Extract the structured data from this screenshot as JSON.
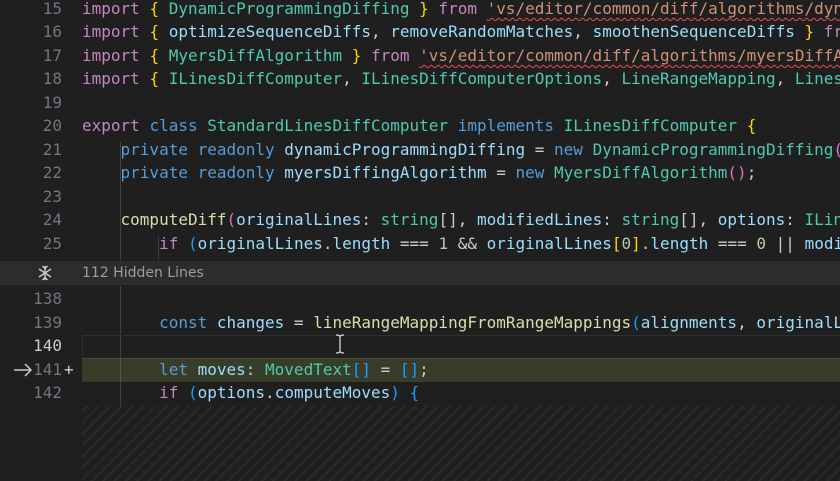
{
  "editor": {
    "lines": [
      {
        "num": "15",
        "tokens": [
          [
            "k",
            "import "
          ],
          [
            "y",
            "{ "
          ],
          [
            "t",
            "DynamicProgrammingDiffing"
          ],
          [
            "y",
            " }"
          ],
          [
            "k",
            " from "
          ],
          [
            "s",
            "'vs/editor/common/diff/algorithms/dyn"
          ]
        ]
      },
      {
        "num": "16",
        "tokens": [
          [
            "k",
            "import "
          ],
          [
            "y",
            "{ "
          ],
          [
            "v",
            "optimizeSequenceDiffs"
          ],
          [
            "p",
            ", "
          ],
          [
            "v",
            "removeRandomMatches"
          ],
          [
            "p",
            ", "
          ],
          [
            "v",
            "smoothenSequenceDiffs"
          ],
          [
            "y",
            " }"
          ],
          [
            "k",
            " fr"
          ]
        ]
      },
      {
        "num": "17",
        "tokens": [
          [
            "k",
            "import "
          ],
          [
            "y",
            "{ "
          ],
          [
            "t",
            "MyersDiffAlgorithm"
          ],
          [
            "y",
            " }"
          ],
          [
            "k",
            " from "
          ],
          [
            "s",
            "'vs/editor/common/diff/algorithms/myersDiffA"
          ]
        ]
      },
      {
        "num": "18",
        "tokens": [
          [
            "k",
            "import "
          ],
          [
            "y",
            "{ "
          ],
          [
            "t",
            "ILinesDiffComputer"
          ],
          [
            "p",
            ", "
          ],
          [
            "t",
            "ILinesDiffComputerOptions"
          ],
          [
            "p",
            ", "
          ],
          [
            "t",
            "LineRangeMapping"
          ],
          [
            "p",
            ", "
          ],
          [
            "t",
            "Lines"
          ]
        ]
      },
      {
        "num": "19",
        "tokens": []
      },
      {
        "num": "20",
        "tokens": [
          [
            "k",
            "export "
          ],
          [
            "kb",
            "class "
          ],
          [
            "t",
            "StandardLinesDiffComputer "
          ],
          [
            "kb",
            "implements "
          ],
          [
            "t",
            "ILinesDiffComputer "
          ],
          [
            "y",
            "{"
          ]
        ]
      },
      {
        "num": "21",
        "tokens": [
          [
            "p",
            "    "
          ],
          [
            "kb",
            "private readonly "
          ],
          [
            "v",
            "dynamicProgrammingDiffing"
          ],
          [
            "p",
            " = "
          ],
          [
            "kb",
            "new "
          ],
          [
            "t",
            "DynamicProgrammingDiffing"
          ],
          [
            "m",
            "("
          ]
        ]
      },
      {
        "num": "22",
        "tokens": [
          [
            "p",
            "    "
          ],
          [
            "kb",
            "private readonly "
          ],
          [
            "v",
            "myersDiffingAlgorithm"
          ],
          [
            "p",
            " = "
          ],
          [
            "kb",
            "new "
          ],
          [
            "t",
            "MyersDiffAlgorithm"
          ],
          [
            "m",
            "()"
          ],
          [
            "p",
            ";"
          ]
        ]
      },
      {
        "num": "23",
        "tokens": []
      },
      {
        "num": "24",
        "tokens": [
          [
            "p",
            "    "
          ],
          [
            "f",
            "computeDiff"
          ],
          [
            "m",
            "("
          ],
          [
            "v",
            "originalLines"
          ],
          [
            "p",
            ": "
          ],
          [
            "t",
            "string"
          ],
          [
            "p",
            "[], "
          ],
          [
            "v",
            "modifiedLines"
          ],
          [
            "p",
            ": "
          ],
          [
            "t",
            "string"
          ],
          [
            "p",
            "[], "
          ],
          [
            "v",
            "options"
          ],
          [
            "p",
            ": "
          ],
          [
            "t",
            "ILin"
          ]
        ]
      },
      {
        "num": "25",
        "tokens": [
          [
            "p",
            "        "
          ],
          [
            "k",
            "if "
          ],
          [
            "bl",
            "("
          ],
          [
            "v",
            "originalLines"
          ],
          [
            "p",
            "."
          ],
          [
            "v",
            "length"
          ],
          [
            "p",
            " === "
          ],
          [
            "n",
            "1"
          ],
          [
            "p",
            " && "
          ],
          [
            "v",
            "originalLines"
          ],
          [
            "y",
            "["
          ],
          [
            "n",
            "0"
          ],
          [
            "y",
            "]"
          ],
          [
            "p",
            "."
          ],
          [
            "v",
            "length"
          ],
          [
            "p",
            " === "
          ],
          [
            "n",
            "0"
          ],
          [
            "p",
            " || "
          ],
          [
            "v",
            "modi"
          ]
        ]
      },
      {
        "num": "138",
        "tokens": []
      },
      {
        "num": "139",
        "tokens": [
          [
            "p",
            "        "
          ],
          [
            "kb",
            "const "
          ],
          [
            "v",
            "changes"
          ],
          [
            "p",
            " = "
          ],
          [
            "f",
            "lineRangeMappingFromRangeMappings"
          ],
          [
            "bl",
            "("
          ],
          [
            "v",
            "alignments"
          ],
          [
            "p",
            ", "
          ],
          [
            "v",
            "originalL"
          ]
        ]
      },
      {
        "num": "140",
        "tokens": []
      },
      {
        "num": "141",
        "tokens": [
          [
            "p",
            "        "
          ],
          [
            "kb",
            "let "
          ],
          [
            "v",
            "moves"
          ],
          [
            "p",
            ": "
          ],
          [
            "t",
            "MovedText"
          ],
          [
            "bl",
            "[]"
          ],
          [
            "p",
            " = "
          ],
          [
            "bl",
            "[]"
          ],
          [
            "p",
            ";"
          ]
        ]
      },
      {
        "num": "142",
        "tokens": [
          [
            "p",
            "        "
          ],
          [
            "k",
            "if "
          ],
          [
            "bl",
            "("
          ],
          [
            "v",
            "options"
          ],
          [
            "p",
            "."
          ],
          [
            "v",
            "computeMoves"
          ],
          [
            "bl",
            ")"
          ],
          [
            "p",
            " "
          ],
          [
            "bl",
            "{"
          ]
        ]
      }
    ],
    "hidden_lines_label": "112 Hidden Lines",
    "added_marker": "+",
    "current_line": "140"
  }
}
